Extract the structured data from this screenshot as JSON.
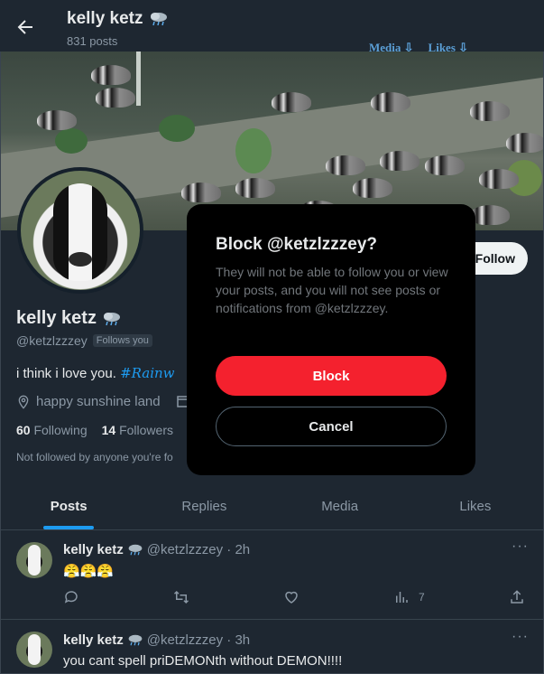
{
  "header": {
    "name": "kelly ketz",
    "posts": "831 posts",
    "links": [
      "Media ⇩",
      "Likes ⇩"
    ]
  },
  "profile": {
    "follow_label": "Follow",
    "name": "kelly ketz",
    "handle": "@ketzlzzzey",
    "follows_you": "Follows you",
    "bio_text": "i think i love you. ",
    "bio_hashtag": "#Rainw",
    "location": "happy sunshine land",
    "following_count": "60",
    "following_label": "Following",
    "followers_count": "14",
    "followers_label": "Followers",
    "not_followed": "Not followed by anyone you're fo"
  },
  "tabs": [
    "Posts",
    "Replies",
    "Media",
    "Likes"
  ],
  "tweets": [
    {
      "name": "kelly ketz",
      "meta": "@ketzlzzzey · 2h",
      "text": "😤😤😤",
      "views": "7"
    },
    {
      "name": "kelly ketz",
      "meta": "@ketzlzzzey · 3h",
      "text": "you cant spell priDEMONth without DEMON!!!!"
    }
  ],
  "modal": {
    "title": "Block @ketzlzzzey?",
    "description": "They will not be able to follow you or view your posts, and you will not see posts or notifications from @ketzlzzzey.",
    "block_label": "Block",
    "cancel_label": "Cancel"
  },
  "colors": {
    "background": "#15202b",
    "accent": "#1d9bf0",
    "danger": "#f4212e",
    "muted": "#8b98a5"
  },
  "icons": {
    "back": "arrow-left-icon",
    "name_badge": "rain-cloud-icon",
    "location": "location-pin-icon",
    "calendar": "calendar-icon",
    "more": "more-dots-icon",
    "reply": "reply-icon",
    "retweet": "retweet-icon",
    "like": "heart-icon",
    "views": "analytics-icon",
    "share": "share-icon"
  }
}
